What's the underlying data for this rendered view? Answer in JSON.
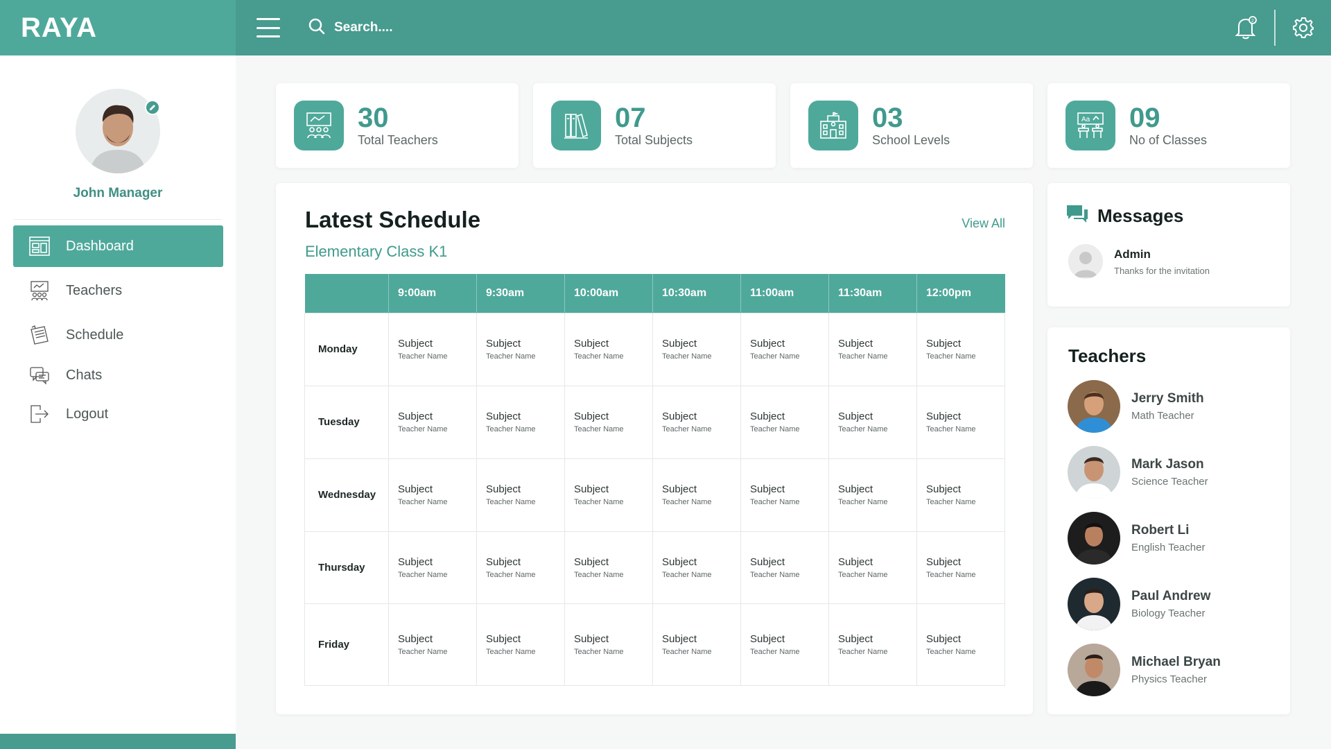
{
  "brand": {
    "name": "RAYA"
  },
  "topbar": {
    "menu_icon": "hamburger-icon",
    "search_placeholder": "Search....",
    "notifications_icon": "bell-icon",
    "settings_icon": "gear-icon"
  },
  "profile": {
    "name": "John Manager"
  },
  "sidebar": {
    "items": [
      {
        "label": "Dashboard",
        "icon": "dashboard-icon",
        "active": true
      },
      {
        "label": "Teachers",
        "icon": "teachers-icon",
        "active": false
      },
      {
        "label": "Schedule",
        "icon": "schedule-icon",
        "active": false
      },
      {
        "label": "Chats",
        "icon": "chat-icon",
        "active": false
      },
      {
        "label": "Logout",
        "icon": "logout-icon",
        "active": false
      }
    ]
  },
  "stats": [
    {
      "value": "30",
      "label": "Total Teachers",
      "icon": "teachers-board-icon"
    },
    {
      "value": "07",
      "label": "Total Subjects",
      "icon": "books-icon"
    },
    {
      "value": "03",
      "label": "School Levels",
      "icon": "school-building-icon"
    },
    {
      "value": "09",
      "label": "No of Classes",
      "icon": "classroom-icon"
    }
  ],
  "schedule": {
    "title": "Latest Schedule",
    "subtitle": "Elementary Class K1",
    "view_all": "View All",
    "times": [
      "9:00am",
      "9:30am",
      "10:00am",
      "10:30am",
      "11:00am",
      "11:30am",
      "12:00pm"
    ],
    "rows": [
      {
        "day": "Monday",
        "cells": [
          {
            "subject": "Subject",
            "teacher": "Teacher Name"
          },
          {
            "subject": "Subject",
            "teacher": "Teacher Name"
          },
          {
            "subject": "Subject",
            "teacher": "Teacher Name"
          },
          {
            "subject": "Subject",
            "teacher": "Teacher Name"
          },
          {
            "subject": "Subject",
            "teacher": "Teacher Name"
          },
          {
            "subject": "Subject",
            "teacher": "Teacher Name"
          },
          {
            "subject": "Subject",
            "teacher": "Teacher Name"
          }
        ]
      },
      {
        "day": "Tuesday",
        "cells": [
          {
            "subject": "Subject",
            "teacher": "Teacher Name"
          },
          {
            "subject": "Subject",
            "teacher": "Teacher Name"
          },
          {
            "subject": "Subject",
            "teacher": "Teacher Name"
          },
          {
            "subject": "Subject",
            "teacher": "Teacher Name"
          },
          {
            "subject": "Subject",
            "teacher": "Teacher Name"
          },
          {
            "subject": "Subject",
            "teacher": "Teacher Name"
          },
          {
            "subject": "Subject",
            "teacher": "Teacher Name"
          }
        ]
      },
      {
        "day": "Wednesday",
        "cells": [
          {
            "subject": "Subject",
            "teacher": "Teacher Name"
          },
          {
            "subject": "Subject",
            "teacher": "Teacher Name"
          },
          {
            "subject": "Subject",
            "teacher": "Teacher Name"
          },
          {
            "subject": "Subject",
            "teacher": "Teacher Name"
          },
          {
            "subject": "Subject",
            "teacher": "Teacher Name"
          },
          {
            "subject": "Subject",
            "teacher": "Teacher Name"
          },
          {
            "subject": "Subject",
            "teacher": "Teacher Name"
          }
        ]
      },
      {
        "day": "Thursday",
        "cells": [
          {
            "subject": "Subject",
            "teacher": "Teacher Name"
          },
          {
            "subject": "Subject",
            "teacher": "Teacher Name"
          },
          {
            "subject": "Subject",
            "teacher": "Teacher Name"
          },
          {
            "subject": "Subject",
            "teacher": "Teacher Name"
          },
          {
            "subject": "Subject",
            "teacher": "Teacher Name"
          },
          {
            "subject": "Subject",
            "teacher": "Teacher Name"
          },
          {
            "subject": "Subject",
            "teacher": "Teacher Name"
          }
        ]
      },
      {
        "day": "Friday",
        "cells": [
          {
            "subject": "Subject",
            "teacher": "Teacher Name"
          },
          {
            "subject": "Subject",
            "teacher": "Teacher Name"
          },
          {
            "subject": "Subject",
            "teacher": "Teacher Name"
          },
          {
            "subject": "Subject",
            "teacher": "Teacher Name"
          },
          {
            "subject": "Subject",
            "teacher": "Teacher Name"
          },
          {
            "subject": "Subject",
            "teacher": "Teacher Name"
          },
          {
            "subject": "Subject",
            "teacher": "Teacher Name"
          }
        ]
      }
    ]
  },
  "messages": {
    "title": "Messages",
    "icon": "chat-bubbles-icon",
    "items": [
      {
        "sender": "Admin",
        "text": "Thanks for the invitation"
      }
    ]
  },
  "teachers": {
    "title": "Teachers",
    "items": [
      {
        "name": "Jerry Smith",
        "role": "Math Teacher"
      },
      {
        "name": "Mark Jason",
        "role": "Science Teacher"
      },
      {
        "name": "Robert Li",
        "role": "English Teacher"
      },
      {
        "name": "Paul Andrew",
        "role": "Biology Teacher"
      },
      {
        "name": "Michael Bryan",
        "role": "Physics Teacher"
      }
    ]
  },
  "colors": {
    "primary": "#479b8f",
    "accent": "#4fa99b",
    "text_accent": "#3f9a8d"
  }
}
